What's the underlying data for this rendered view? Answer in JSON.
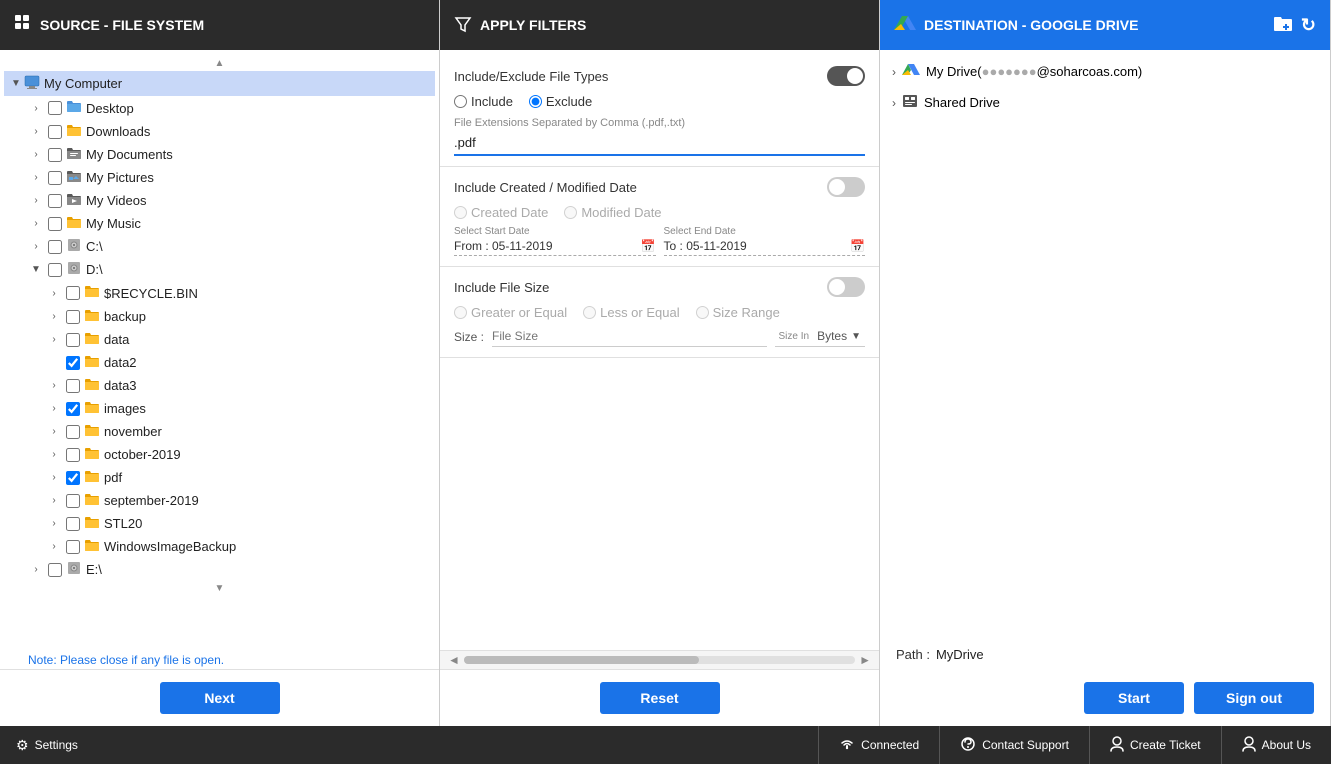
{
  "source_panel": {
    "header": "SOURCE - FILE SYSTEM",
    "note": "Note: Please close if any file is open.",
    "next_button": "Next",
    "tree": {
      "root": {
        "label": "My Computer",
        "expanded": true,
        "selected": true,
        "children": [
          {
            "label": "Desktop",
            "checked": false,
            "expanded": false,
            "type": "folder-special"
          },
          {
            "label": "Downloads",
            "checked": false,
            "expanded": false,
            "type": "folder-special"
          },
          {
            "label": "My Documents",
            "checked": false,
            "expanded": false,
            "type": "folder-special"
          },
          {
            "label": "My Pictures",
            "checked": false,
            "expanded": false,
            "type": "folder-special"
          },
          {
            "label": "My Videos",
            "checked": false,
            "expanded": false,
            "type": "folder-special"
          },
          {
            "label": "My Music",
            "checked": false,
            "expanded": false,
            "type": "folder-special"
          },
          {
            "label": "C:\\",
            "checked": false,
            "expanded": false,
            "type": "disk"
          },
          {
            "label": "D:\\",
            "checked": false,
            "expanded": true,
            "type": "disk",
            "children": [
              {
                "label": "$RECYCLE.BIN",
                "checked": false,
                "expanded": false,
                "type": "folder"
              },
              {
                "label": "backup",
                "checked": false,
                "expanded": false,
                "type": "folder"
              },
              {
                "label": "data",
                "checked": false,
                "expanded": false,
                "type": "folder"
              },
              {
                "label": "data2",
                "checked": true,
                "expanded": false,
                "type": "folder"
              },
              {
                "label": "data3",
                "checked": false,
                "expanded": false,
                "type": "folder"
              },
              {
                "label": "images",
                "checked": true,
                "expanded": false,
                "type": "folder"
              },
              {
                "label": "november",
                "checked": false,
                "expanded": false,
                "type": "folder"
              },
              {
                "label": "october-2019",
                "checked": false,
                "expanded": false,
                "type": "folder"
              },
              {
                "label": "pdf",
                "checked": true,
                "expanded": false,
                "type": "folder"
              },
              {
                "label": "september-2019",
                "checked": false,
                "expanded": false,
                "type": "folder"
              },
              {
                "label": "STL20",
                "checked": false,
                "expanded": false,
                "type": "folder"
              },
              {
                "label": "WindowsImageBackup",
                "checked": false,
                "expanded": false,
                "type": "folder"
              }
            ]
          },
          {
            "label": "E:\\",
            "checked": false,
            "expanded": false,
            "type": "disk"
          }
        ]
      }
    }
  },
  "filters_panel": {
    "header": "APPLY FILTERS",
    "reset_button": "Reset",
    "file_types": {
      "title": "Include/Exclude File Types",
      "toggle_on": true,
      "include_label": "Include",
      "exclude_label": "Exclude",
      "selected": "exclude",
      "input_label": "File Extensions Separated by Comma (.pdf,.txt)",
      "input_value": ".pdf"
    },
    "date_filter": {
      "title": "Include Created / Modified Date",
      "toggle_on": false,
      "created_label": "Created Date",
      "modified_label": "Modified Date",
      "from_label": "Select Start Date",
      "from_prefix": "From : ",
      "from_value": "05-11-2019",
      "to_label": "Select End Date",
      "to_prefix": "To : ",
      "to_value": "05-11-2019"
    },
    "size_filter": {
      "title": "Include File Size",
      "toggle_on": false,
      "greater_label": "Greater or Equal",
      "less_label": "Less or Equal",
      "range_label": "Size Range",
      "size_label": "Size :",
      "size_placeholder": "File Size",
      "unit_label": "Size In",
      "unit_value": "Bytes"
    }
  },
  "destination_panel": {
    "header": "DESTINATION - GOOGLE DRIVE",
    "start_button": "Start",
    "signout_button": "Sign out",
    "path_label": "Path :",
    "path_value": "MyDrive",
    "tree": [
      {
        "label": "My Drive(●●●●●●●@soharcoas.com)",
        "type": "drive",
        "expanded": false
      },
      {
        "label": "Shared Drive",
        "type": "shared",
        "expanded": false
      }
    ]
  },
  "status_bar": {
    "settings_label": "Settings",
    "connected_label": "Connected",
    "support_label": "Contact Support",
    "ticket_label": "Create Ticket",
    "about_label": "About Us"
  },
  "icons": {
    "source_icon": "⊞",
    "filter_icon": "▽",
    "gdrive_icon": "◈",
    "settings_icon": "⚙",
    "wifi_icon": "📶",
    "support_icon": "☎",
    "ticket_icon": "👤",
    "about_icon": "👤",
    "toggle_arrow_right": "›",
    "toggle_arrow_down": "∨",
    "calendar_icon": "📅",
    "folder_icon": "📁",
    "computer_icon": "💻",
    "disk_icon": "💾",
    "add_folder_icon": "📁",
    "refresh_icon": "↻",
    "lock_icon": "🔒",
    "drive_icon": "▲"
  }
}
